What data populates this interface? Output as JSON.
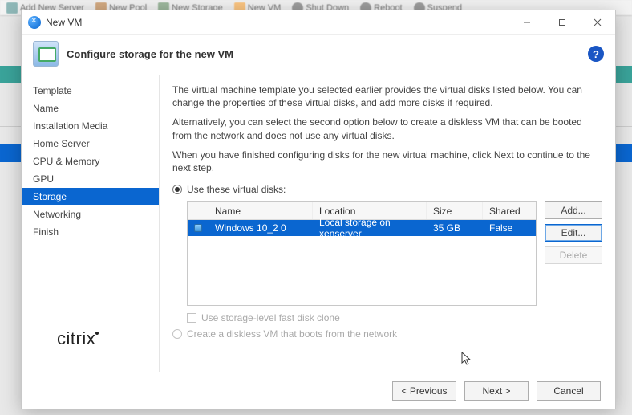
{
  "bg_toolbar": {
    "items": [
      "Add New Server",
      "New Pool",
      "New Storage",
      "New VM",
      "Shut Down",
      "Reboot",
      "Suspend"
    ]
  },
  "titlebar": {
    "title": "New VM"
  },
  "header": {
    "title": "Configure storage for the new VM"
  },
  "sidebar": {
    "items": [
      {
        "label": "Template"
      },
      {
        "label": "Name"
      },
      {
        "label": "Installation Media"
      },
      {
        "label": "Home Server"
      },
      {
        "label": "CPU & Memory"
      },
      {
        "label": "GPU"
      },
      {
        "label": "Storage",
        "selected": true
      },
      {
        "label": "Networking"
      },
      {
        "label": "Finish"
      }
    ]
  },
  "main": {
    "p1": "The virtual machine template you selected earlier provides the virtual disks listed below. You can change the properties of these virtual disks, and add more disks if required.",
    "p2": "Alternatively, you can select the second option below to create a diskless VM that can be booted from the network and does not use any virtual disks.",
    "p3": "When you have finished configuring disks for the new virtual machine, click Next to continue to the next step.",
    "radio_use": "Use these virtual disks:",
    "columns": {
      "name": "Name",
      "location": "Location",
      "size": "Size",
      "shared": "Shared"
    },
    "rows": [
      {
        "name": "Windows 10_2 0",
        "location": "Local storage on xenserver",
        "size": "35 GB",
        "shared": "False"
      }
    ],
    "buttons": {
      "add": "Add...",
      "edit": "Edit...",
      "del": "Delete"
    },
    "check_clone": "Use storage-level fast disk clone",
    "radio_diskless": "Create a diskless VM that boots from the network"
  },
  "brand": "citrix",
  "footer": {
    "prev": "< Previous",
    "next": "Next >",
    "cancel": "Cancel"
  }
}
